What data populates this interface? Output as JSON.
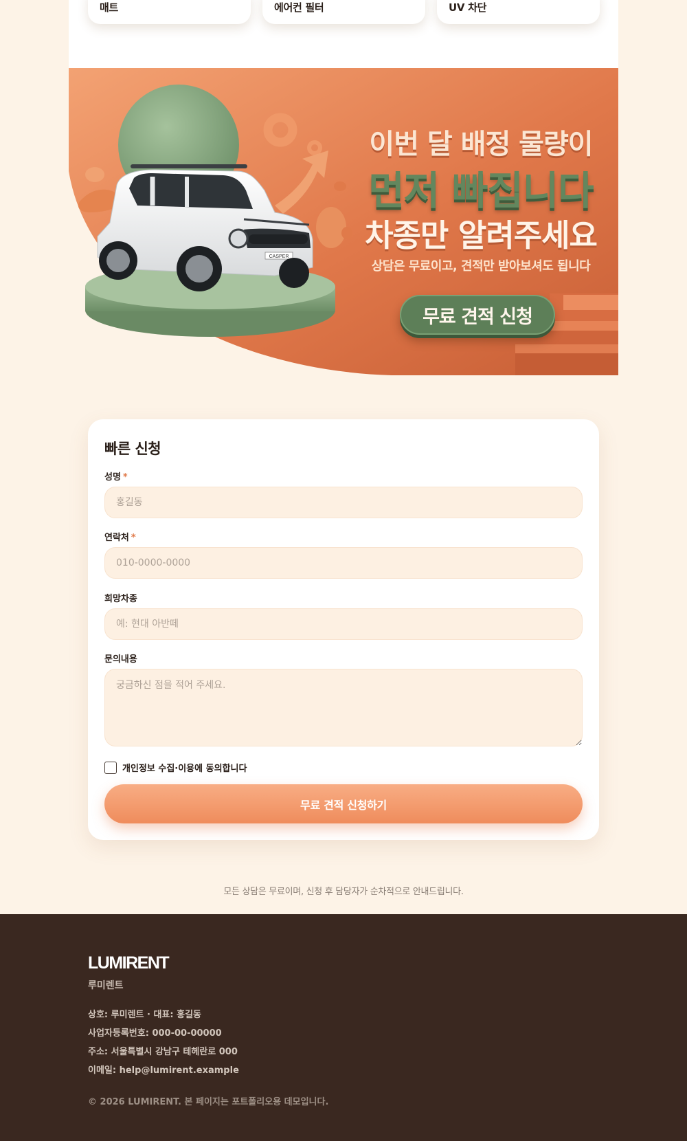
{
  "features": [
    "매트",
    "에어컨 필터",
    "UV 차단"
  ],
  "banner": {
    "line1": "이번 달 배정 물량이",
    "line2": "먼저 빠집니다",
    "line3": "차종만 알려주세요",
    "line4": "상담은 무료이고, 견적만 받아보셔도 됩니다",
    "cta": "무료 견적 신청",
    "car_plate": "CASPER",
    "colors": {
      "orange": "#e07a4a",
      "green": "#6f916a",
      "cream": "#fdf3e7"
    }
  },
  "form": {
    "title": "빠른 신청",
    "required_mark": "*",
    "name_label": "성명",
    "name_placeholder": "홍길동",
    "phone_label": "연락처",
    "phone_placeholder": "010-0000-0000",
    "car_label": "희망차종",
    "car_placeholder": "예: 현대 아반떼",
    "message_label": "문의내용",
    "message_placeholder": "궁금하신 점을 적어 주세요.",
    "consent_label": "개인정보 수집·이용에 동의합니다",
    "consent_checked": false,
    "submit_label": "무료 견적 신청하기"
  },
  "notice": "모든 상담은 무료이며, 신청 후 담당자가 순차적으로 안내드립니다.",
  "footer": {
    "logo": "LUMIRENT",
    "brand": "루미렌트",
    "company": "상호: 루미렌트 · 대표: 홍길동",
    "business_no": "사업자등록번호: 000-00-00000",
    "address": "주소: 서울특별시 강남구 테헤란로 000",
    "email": "이메일: help@lumirent.example",
    "copyright": "© 2026 LUMIRENT. 본 페이지는 포트폴리오용 데모입니다."
  }
}
